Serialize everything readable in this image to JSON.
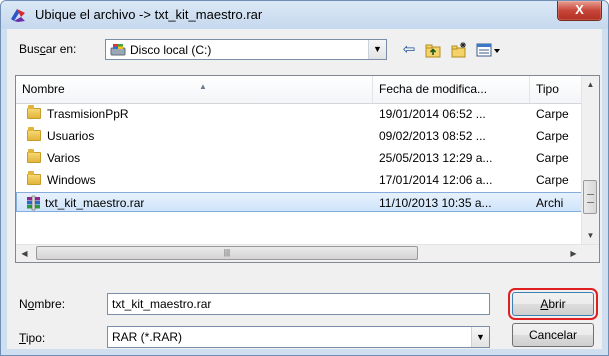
{
  "window": {
    "title": "Ubique el archivo -> txt_kit_maestro.rar",
    "close_label": "X"
  },
  "lookin": {
    "label_pre": "Bus",
    "label_key": "c",
    "label_post": "ar en:",
    "value": "Disco local (C:)"
  },
  "toolbar": {
    "back_icon": "⇦",
    "up_icon": "📁",
    "new_folder_icon": "✳",
    "views_icon": "▦▾"
  },
  "columns": {
    "name": "Nombre",
    "date": "Fecha de modifica...",
    "type": "Tipo"
  },
  "files": [
    {
      "name": "TrasmisionPpR",
      "date": "19/01/2014 06:52 ...",
      "type": "Carpe",
      "kind": "folder"
    },
    {
      "name": "Usuarios",
      "date": "09/02/2013 08:52 ...",
      "type": "Carpe",
      "kind": "folder"
    },
    {
      "name": "Varios",
      "date": "25/05/2013 12:29 a...",
      "type": "Carpe",
      "kind": "folder"
    },
    {
      "name": "Windows",
      "date": "17/01/2014 12:06 a...",
      "type": "Carpe",
      "kind": "folder"
    },
    {
      "name": "txt_kit_maestro.rar",
      "date": "11/10/2013 10:35 a...",
      "type": "Archi",
      "kind": "rar"
    }
  ],
  "filename": {
    "label_pre": "N",
    "label_key": "o",
    "label_post": "mbre:",
    "value": "txt_kit_maestro.rar"
  },
  "filetype": {
    "label_key": "T",
    "label_post": "ipo:",
    "value": "RAR (*.RAR)"
  },
  "buttons": {
    "open_key": "A",
    "open_post": "brir",
    "cancel": "Cancelar"
  },
  "colors": {
    "highlight": "#e02020",
    "selection": "#cfe4fb"
  }
}
